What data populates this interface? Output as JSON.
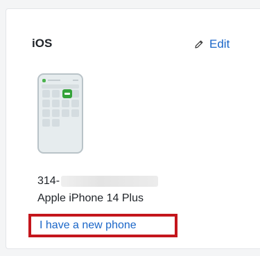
{
  "card": {
    "title": "iOS",
    "edit_label": "Edit"
  },
  "device": {
    "number_prefix": "314-",
    "model": "Apple iPhone 14 Plus",
    "new_phone_link": "I have a new phone"
  },
  "icons": {
    "edit": "pencil-icon",
    "device": "phone-illustration"
  },
  "colors": {
    "link": "#1a66c8",
    "highlight_border": "#c4161c",
    "app_icon": "#35a33a"
  }
}
